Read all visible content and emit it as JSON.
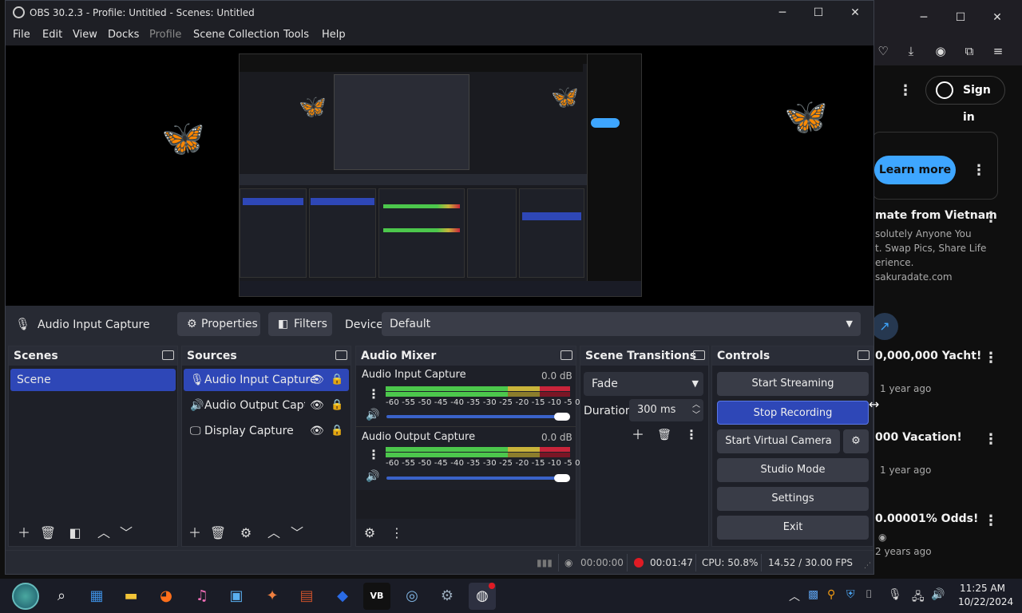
{
  "obs": {
    "title": "OBS 30.2.3 - Profile: Untitled - Scenes: Untitled",
    "menus": [
      {
        "label": "File",
        "enabled": true
      },
      {
        "label": "Edit",
        "enabled": true
      },
      {
        "label": "View",
        "enabled": true
      },
      {
        "label": "Docks",
        "enabled": true
      },
      {
        "label": "Profile",
        "enabled": false
      },
      {
        "label": "Scene Collection",
        "enabled": true
      },
      {
        "label": "Tools",
        "enabled": true
      },
      {
        "label": "Help",
        "enabled": true
      }
    ],
    "source_bar": {
      "selected_source": "Audio Input Capture",
      "properties_label": "Properties",
      "filters_label": "Filters",
      "device_label": "Device",
      "device_value": "Default"
    },
    "scenes": {
      "title": "Scenes",
      "items": [
        "Scene"
      ]
    },
    "sources": {
      "title": "Sources",
      "items": [
        {
          "label": "Audio Input Capture",
          "icon": "microphone-icon",
          "selected": true
        },
        {
          "label": "Audio Output Captur",
          "icon": "speaker-icon",
          "selected": false
        },
        {
          "label": "Display Capture",
          "icon": "monitor-icon",
          "selected": false
        }
      ]
    },
    "mixer": {
      "title": "Audio Mixer",
      "ticks": "-60 -55 -50 -45 -40 -35 -30 -25 -20 -15 -10 -5 0",
      "channels": [
        {
          "name": "Audio Input Capture",
          "db": "0.0 dB"
        },
        {
          "name": "Audio Output Capture",
          "db": "0.0 dB"
        }
      ]
    },
    "transitions": {
      "title": "Scene Transitions",
      "type": "Fade",
      "duration_label": "Duration",
      "duration_value": "300 ms"
    },
    "controls": {
      "title": "Controls",
      "start_streaming": "Start Streaming",
      "stop_recording": "Stop Recording",
      "start_virtual_camera": "Start Virtual Camera",
      "studio_mode": "Studio Mode",
      "settings": "Settings",
      "exit": "Exit"
    },
    "status": {
      "stream_time": "00:00:00",
      "rec_time": "00:01:47",
      "cpu": "CPU: 50.8%",
      "fps": "14.52 / 30.00 FPS"
    },
    "colors": {
      "accent": "#2e47b7",
      "meter_green": "#4cc74c",
      "meter_yellow": "#c9b43a",
      "meter_red": "#c8243a",
      "rec_red": "#e01b24"
    }
  },
  "browser": {
    "sign_in": "Sign in",
    "learn_more": "Learn more",
    "ad_title": "mate from Vietnam",
    "ad_line1": "solutely Anyone You",
    "ad_line2": "t. Swap Pics, Share Life",
    "ad_line3": "erience.",
    "ad_domain": "sakuradate.com",
    "videos": [
      {
        "title": "0,000,000 Yacht!",
        "age": "1 year ago"
      },
      {
        "title": "000 Vacation!",
        "age": "1 year ago"
      },
      {
        "title": "0.00001% Odds!",
        "age": "2 years ago"
      }
    ]
  },
  "taskbar": {
    "time": "11:25 AM",
    "date": "10/22/2024",
    "apps": [
      "globe-icon",
      "search-icon",
      "widgets-icon",
      "file-explorer-icon",
      "firefox-icon",
      "music-icon",
      "store-icon",
      "app-icon",
      "archive-icon",
      "folder-icon",
      "vb-icon",
      "steam-icon",
      "settings-icon",
      "obs-icon"
    ]
  }
}
